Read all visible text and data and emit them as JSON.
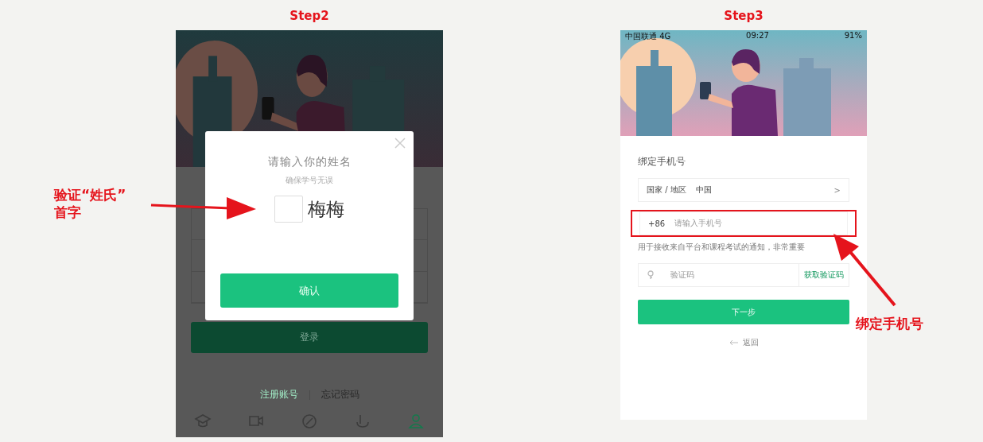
{
  "step2": {
    "title": "Step2",
    "login": {
      "button": "登录",
      "links": [
        "注册账号",
        "忘记密码"
      ],
      "tabs": [
        {
          "selected": false
        },
        {
          "selected": false
        },
        {
          "selected": false
        },
        {
          "selected": false
        },
        {
          "selected": true
        }
      ]
    },
    "modal": {
      "title": "请输入你的姓名",
      "subtitle": "确保学号无误",
      "given_name": "梅梅",
      "confirm": "确认"
    }
  },
  "step3": {
    "title": "Step3",
    "status_bar": {
      "carrier": "中国联通 4G",
      "time": "09:27",
      "battery": "91%"
    },
    "heading": "绑定手机号",
    "region": {
      "label": "国家 / 地区",
      "value": "中国",
      "chevron": ">"
    },
    "phone_field": {
      "prefix": "+86",
      "placeholder": "请输入手机号",
      "highlighted": true
    },
    "helper": "用于接收来自平台和课程考试的通知，非常重要",
    "code_field": {
      "placeholder": "验证码",
      "action": "获取验证码"
    },
    "next": "下一步",
    "back": "返回"
  },
  "annotations": [
    {
      "text": "验证“姓氏”\n首字"
    },
    {
      "text": "绑定手机号"
    }
  ]
}
